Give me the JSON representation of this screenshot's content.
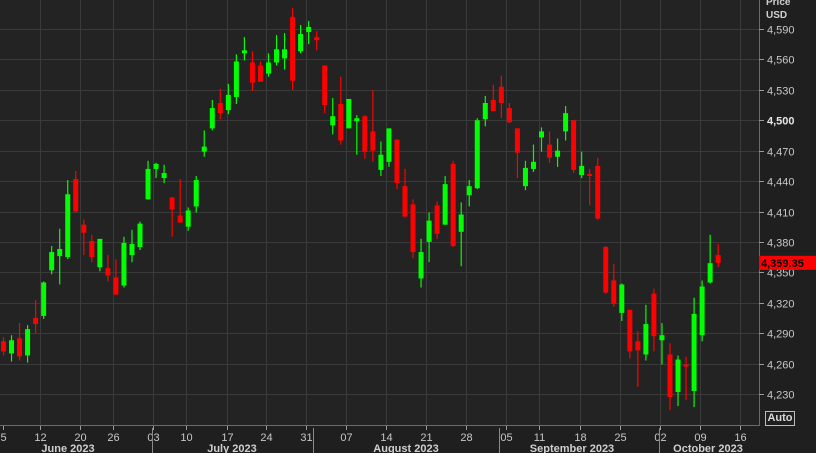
{
  "chart_data": {
    "type": "candlestick",
    "title": "",
    "ylabel": "Price USD",
    "ylabel_lines": [
      "Price",
      "USD"
    ],
    "ylim": [
      4205,
      4615
    ],
    "yticks": [
      "4,230",
      "4,260",
      "4,290",
      "4,320",
      "4,350",
      "4,380",
      "4,410",
      "4,440",
      "4,470",
      "4,500",
      "4,530",
      "4,560",
      "4,590"
    ],
    "ytick_values": [
      4230,
      4260,
      4290,
      4320,
      4350,
      4380,
      4410,
      4440,
      4470,
      4500,
      4530,
      4560,
      4590
    ],
    "bold_ytick": "4,500",
    "last_price_label": "4,359.35",
    "last_price": 4359.35,
    "grid": true,
    "xticks": [
      "5",
      "12",
      "20",
      "26",
      "03",
      "10",
      "17",
      "24",
      "31",
      "07",
      "14",
      "21",
      "28",
      "05",
      "11",
      "18",
      "25",
      "02",
      "09",
      "16"
    ],
    "months": [
      "June 2023",
      "July 2023",
      "August 2023",
      "September 2023",
      "October 2023"
    ],
    "up_color": "#00ff00",
    "down_color": "#ff0000",
    "candles": [
      [
        4282,
        4286,
        4268,
        4272
      ],
      [
        4270,
        4288,
        4262,
        4283
      ],
      [
        4285,
        4300,
        4263,
        4267
      ],
      [
        4268,
        4298,
        4261,
        4294
      ],
      [
        4305,
        4323,
        4290,
        4299
      ],
      [
        4307,
        4341,
        4304,
        4340
      ],
      [
        4352,
        4376,
        4348,
        4370
      ],
      [
        4366,
        4393,
        4338,
        4373
      ],
      [
        4365,
        4441,
        4363,
        4427
      ],
      [
        4442,
        4450,
        4409,
        4410
      ],
      [
        4397,
        4402,
        4367,
        4389
      ],
      [
        4381,
        4387,
        4360,
        4365
      ],
      [
        4355,
        4383,
        4351,
        4383
      ],
      [
        4354,
        4367,
        4341,
        4347
      ],
      [
        4345,
        4363,
        4328,
        4328
      ],
      [
        4337,
        4385,
        4335,
        4379
      ],
      [
        4367,
        4392,
        4360,
        4378
      ],
      [
        4375,
        4400,
        4372,
        4398
      ],
      [
        4422,
        4460,
        4422,
        4452
      ],
      [
        4452,
        4458,
        4443,
        4457
      ],
      [
        4443,
        4456,
        4438,
        4448
      ],
      [
        4424,
        4424,
        4385,
        4412
      ],
      [
        4406,
        4442,
        4399,
        4399
      ],
      [
        4395,
        4414,
        4391,
        4411
      ],
      [
        4415,
        4445,
        4409,
        4441
      ],
      [
        4469,
        4490,
        4464,
        4474
      ],
      [
        4492,
        4520,
        4490,
        4512
      ],
      [
        4517,
        4531,
        4501,
        4507
      ],
      [
        4510,
        4536,
        4506,
        4525
      ],
      [
        4523,
        4565,
        4516,
        4558
      ],
      [
        4566,
        4582,
        4559,
        4569
      ],
      [
        4557,
        4568,
        4529,
        4537
      ],
      [
        4554,
        4558,
        4538,
        4538
      ],
      [
        4546,
        4566,
        4543,
        4557
      ],
      [
        4557,
        4584,
        4554,
        4570
      ],
      [
        4561,
        4586,
        4550,
        4570
      ],
      [
        4602,
        4611,
        4530,
        4539
      ],
      [
        4568,
        4594,
        4566,
        4585
      ],
      [
        4587,
        4598,
        4575,
        4592
      ],
      [
        4582,
        4588,
        4569,
        4579
      ],
      [
        4554,
        4554,
        4507,
        4515
      ],
      [
        4495,
        4522,
        4486,
        4504
      ],
      [
        4516,
        4543,
        4476,
        4480
      ],
      [
        4492,
        4521,
        4492,
        4521
      ],
      [
        4499,
        4505,
        4466,
        4502
      ],
      [
        4504,
        4505,
        4462,
        4469
      ],
      [
        4489,
        4530,
        4459,
        4470
      ],
      [
        4451,
        4479,
        4445,
        4466
      ],
      [
        4459,
        4492,
        4454,
        4492
      ],
      [
        4481,
        4481,
        4432,
        4438
      ],
      [
        4435,
        4452,
        4404,
        4405
      ],
      [
        4417,
        4422,
        4364,
        4370
      ],
      [
        4344,
        4383,
        4335,
        4370
      ],
      [
        4380,
        4409,
        4360,
        4401
      ],
      [
        4416,
        4420,
        4383,
        4388
      ],
      [
        4397,
        4445,
        4397,
        4437
      ],
      [
        4457,
        4460,
        4375,
        4376
      ],
      [
        4390,
        4419,
        4356,
        4407
      ],
      [
        4426,
        4441,
        4415,
        4435
      ],
      [
        4433,
        4502,
        4432,
        4500
      ],
      [
        4501,
        4524,
        4494,
        4517
      ],
      [
        4520,
        4535,
        4509,
        4509
      ],
      [
        4533,
        4544,
        4502,
        4517
      ],
      [
        4512,
        4517,
        4497,
        4498
      ],
      [
        4492,
        4492,
        4443,
        4468
      ],
      [
        4435,
        4460,
        4431,
        4453
      ],
      [
        4452,
        4476,
        4449,
        4459
      ],
      [
        4483,
        4493,
        4469,
        4489
      ],
      [
        4476,
        4489,
        4458,
        4463
      ],
      [
        4464,
        4482,
        4454,
        4470
      ],
      [
        4489,
        4514,
        4480,
        4507
      ],
      [
        4500,
        4500,
        4448,
        4451
      ],
      [
        4446,
        4469,
        4443,
        4455
      ],
      [
        4447,
        4452,
        4416,
        4445
      ],
      [
        4455,
        4463,
        4402,
        4403
      ],
      [
        4375,
        4376,
        4329,
        4330
      ],
      [
        4342,
        4358,
        4316,
        4319
      ],
      [
        4310,
        4339,
        4302,
        4338
      ],
      [
        4313,
        4313,
        4265,
        4272
      ],
      [
        4282,
        4292,
        4237,
        4273
      ],
      [
        4269,
        4318,
        4263,
        4299
      ],
      [
        4329,
        4334,
        4272,
        4287
      ],
      [
        4283,
        4300,
        4259,
        4288
      ],
      [
        4269,
        4280,
        4214,
        4227
      ],
      [
        4232,
        4268,
        4218,
        4264
      ],
      [
        4259,
        4267,
        4224,
        4257
      ],
      [
        4233,
        4325,
        4217,
        4309
      ],
      [
        4288,
        4342,
        4282,
        4336
      ],
      [
        4340,
        4387,
        4339,
        4359
      ],
      [
        4367,
        4378,
        4355,
        4359.35
      ]
    ]
  },
  "controls": {
    "auto_label": "Auto"
  }
}
